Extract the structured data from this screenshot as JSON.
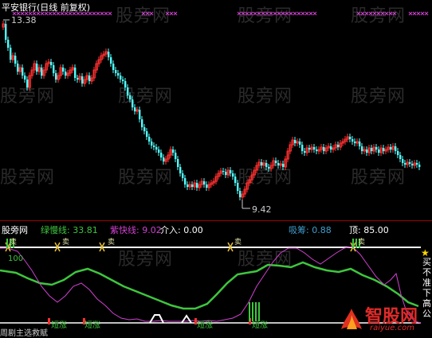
{
  "watermark": "股旁网",
  "top_panel": {
    "title": "平安银行(日线 前复权)",
    "price_high_label": "13.38",
    "price_low_label": "9.42"
  },
  "bottom_panel": {
    "left_caption": "股旁网",
    "indicators": [
      {
        "name": "绿慢线:",
        "value": "33.81",
        "color": "#3ec63e"
      },
      {
        "name": "紫快线:",
        "value": "9.02",
        "color": "#d040d0"
      },
      {
        "name": "介入:",
        "value": "0.00",
        "color": "#ffffff"
      },
      {
        "name": "吸筹:",
        "value": "0.88",
        "color": "#3fa0d0"
      },
      {
        "name": "顶:",
        "value": "85.00",
        "color": "#ffffff"
      }
    ],
    "marker_top": "卖",
    "marker_bottom": "短涨",
    "right_vertical_text": "买不准下高公",
    "bottom_left_text": "周剧主选救赋",
    "left_level": "100"
  },
  "brand": {
    "name": "智股网",
    "url": "raiyue.com"
  },
  "colors": {
    "up_candle": "#ff3030",
    "down_candle": "#54ffff",
    "green_line": "#3ec63e",
    "purple_line": "#d040d0"
  }
}
